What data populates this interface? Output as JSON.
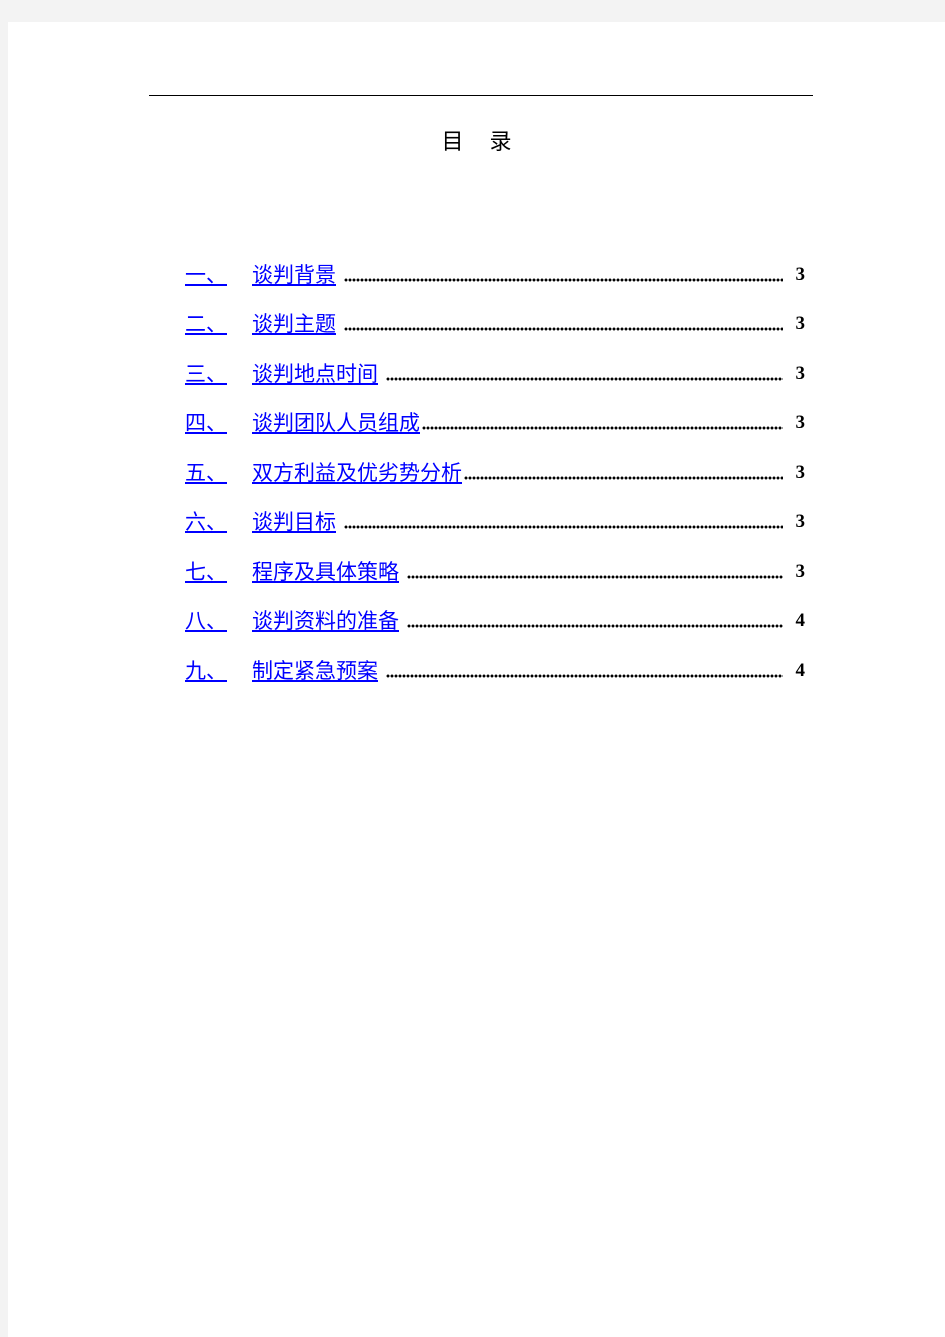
{
  "document": {
    "title": "目录",
    "title_chars": [
      "目",
      "录"
    ],
    "link_color": "#0000ff",
    "toc": [
      {
        "num": "一、",
        "label": "谈判背景",
        "page": "3"
      },
      {
        "num": "二、",
        "label": "谈判主题",
        "page": "3"
      },
      {
        "num": "三、",
        "label": "谈判地点时间",
        "page": "3"
      },
      {
        "num": "四、",
        "label": "谈判团队人员组成",
        "page": "3"
      },
      {
        "num": "五、",
        "label": "双方利益及优劣势分析",
        "page": "3"
      },
      {
        "num": "六、",
        "label": "谈判目标",
        "page": "3"
      },
      {
        "num": "七、",
        "label": "程序及具体策略",
        "page": "3"
      },
      {
        "num": "八、",
        "label": "谈判资料的准备",
        "page": "4"
      },
      {
        "num": "九、",
        "label": "制定紧急预案",
        "page": "4"
      }
    ]
  }
}
